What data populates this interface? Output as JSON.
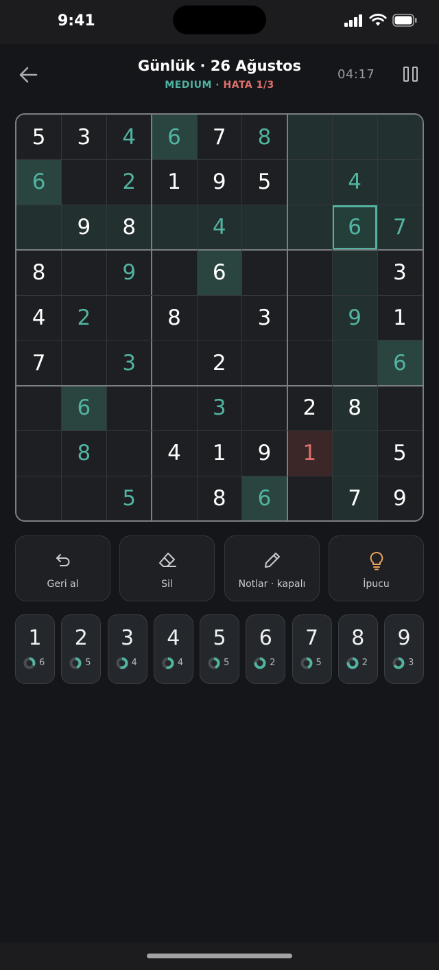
{
  "status": {
    "time": "9:41"
  },
  "header": {
    "title": "Günlük · 26 Ağustos",
    "difficulty": "MEDIUM",
    "separator": " · ",
    "errors": "HATA 1/3",
    "timer": "04:17"
  },
  "board": {
    "rows": [
      [
        "5",
        "3",
        "4",
        "6",
        "7",
        "8",
        "",
        "",
        ""
      ],
      [
        "6",
        "",
        "2",
        "1",
        "9",
        "5",
        "",
        "4",
        ""
      ],
      [
        "",
        "9",
        "8",
        "",
        "4",
        "",
        "",
        "6",
        "7"
      ],
      [
        "8",
        "",
        "9",
        "",
        "6",
        "",
        "",
        "",
        "3"
      ],
      [
        "4",
        "2",
        "",
        "8",
        "",
        "3",
        "",
        "9",
        "1"
      ],
      [
        "7",
        "",
        "3",
        "",
        "2",
        "",
        "",
        "",
        "6"
      ],
      [
        "",
        "6",
        "",
        "",
        "3",
        "",
        "2",
        "8",
        ""
      ],
      [
        "",
        "8",
        "",
        "4",
        "1",
        "9",
        "1",
        "",
        "5"
      ],
      [
        "",
        "",
        "5",
        "",
        "8",
        "6",
        "",
        "7",
        "9"
      ]
    ],
    "user_entered": [
      [
        0,
        2
      ],
      [
        0,
        3
      ],
      [
        0,
        5
      ],
      [
        1,
        0
      ],
      [
        1,
        2
      ],
      [
        1,
        7
      ],
      [
        2,
        4
      ],
      [
        2,
        7
      ],
      [
        2,
        8
      ],
      [
        3,
        2
      ],
      [
        4,
        1
      ],
      [
        4,
        7
      ],
      [
        5,
        2
      ],
      [
        5,
        8
      ],
      [
        6,
        1
      ],
      [
        6,
        4
      ],
      [
        7,
        1
      ],
      [
        7,
        6
      ],
      [
        8,
        2
      ],
      [
        8,
        5
      ]
    ],
    "error_cells": [
      [
        7,
        6
      ]
    ],
    "selected": [
      2,
      7
    ],
    "selected_value": "6",
    "colors": {
      "user": "#52b3a0",
      "error": "#e0706c",
      "given": "#ffffff"
    }
  },
  "tools": [
    {
      "label": "Geri al",
      "icon": "undo-icon"
    },
    {
      "label": "Sil",
      "icon": "eraser-icon"
    },
    {
      "label": "Notlar · kapalı",
      "icon": "pencil-icon"
    },
    {
      "label": "İpucu",
      "icon": "lightbulb-icon"
    }
  ],
  "numpad": [
    {
      "digit": "1",
      "remaining": "6"
    },
    {
      "digit": "2",
      "remaining": "5"
    },
    {
      "digit": "3",
      "remaining": "4"
    },
    {
      "digit": "4",
      "remaining": "4"
    },
    {
      "digit": "5",
      "remaining": "5"
    },
    {
      "digit": "6",
      "remaining": "2"
    },
    {
      "digit": "7",
      "remaining": "5"
    },
    {
      "digit": "8",
      "remaining": "2"
    },
    {
      "digit": "9",
      "remaining": "3"
    }
  ]
}
